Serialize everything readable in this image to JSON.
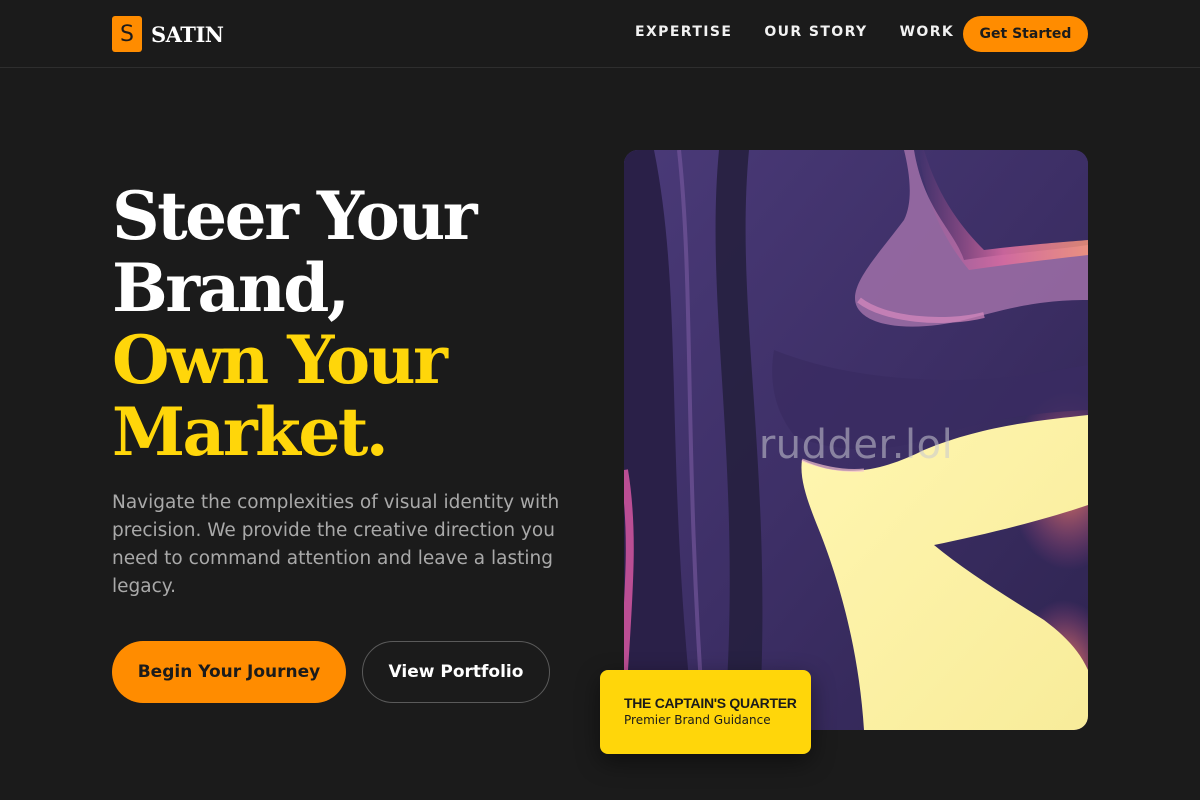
{
  "brand": {
    "logo_letter": "S",
    "name": "SATIN"
  },
  "nav": {
    "links": [
      "EXPERTISE",
      "OUR STORY",
      "WORK"
    ],
    "cta": "Get Started"
  },
  "hero": {
    "title_lines": [
      "Steer Your",
      "Brand,"
    ],
    "title_accent_lines": [
      "Own Your",
      "Market."
    ],
    "description": "Navigate the complexities of visual identity with precision. We provide the creative direction you need to command attention and leave a lasting legacy.",
    "primary_button": "Begin Your Journey",
    "secondary_button": "View Portfolio"
  },
  "art": {
    "watermark": "rudder.lol"
  },
  "badge": {
    "title": "THE CAPTAIN'S QUARTER",
    "subtitle": "Premier Brand Guidance"
  },
  "colors": {
    "accent_orange": "#ff8c00",
    "accent_yellow": "#ffd60a",
    "background": "#1b1b1b"
  }
}
